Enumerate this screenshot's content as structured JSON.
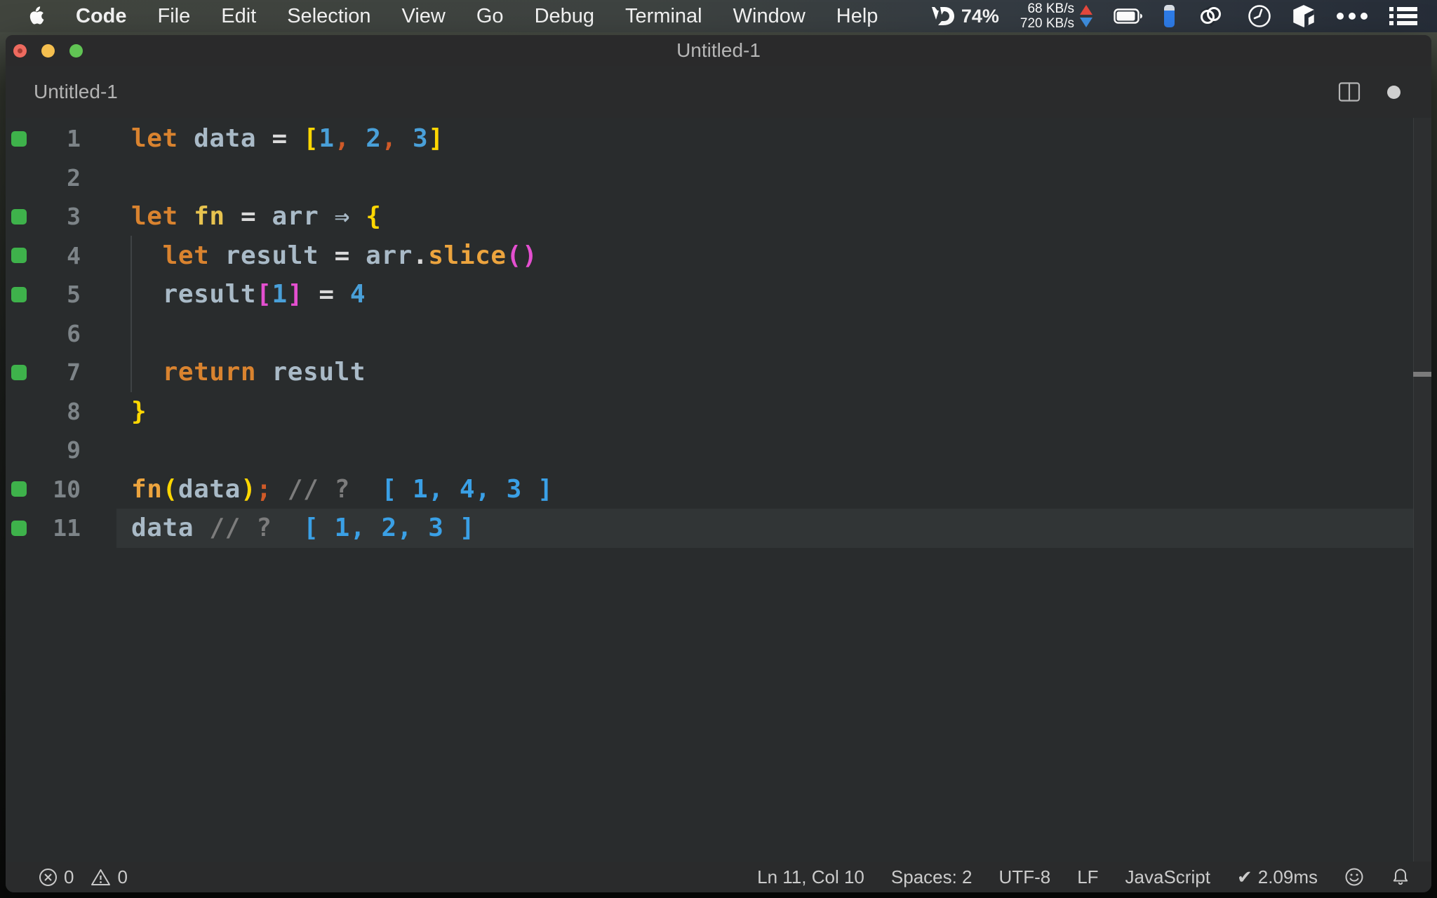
{
  "palette": {
    "kw": "#d9832f",
    "id": "#a9bac7",
    "op": "#d9d9d9",
    "num": "#49a0d9",
    "by": "#ffd702",
    "bm": "#e44fd0",
    "pr": "#cf5a28",
    "fy": "#e7c34f",
    "fa": "#eca43e",
    "cm": "#7c7c7c",
    "ann": "#3aa0e6",
    "ar": "#a9bac7",
    "gutter_green": "#3eb24b",
    "line_num": "#7d8488",
    "editor_bg": "#292c2d",
    "current_line": "#313536",
    "net_up_arrow": "#e5483d",
    "net_down_arrow": "#3f8fe0",
    "traffic_red": "#ee6a5f",
    "traffic_yellow": "#f5bf4f",
    "traffic_green": "#61c454"
  },
  "menubar": {
    "apple_icon": "apple-logo",
    "items": [
      {
        "label": "Code",
        "bold": true
      },
      {
        "label": "File"
      },
      {
        "label": "Edit"
      },
      {
        "label": "Selection"
      },
      {
        "label": "View"
      },
      {
        "label": "Go"
      },
      {
        "label": "Debug"
      },
      {
        "label": "Terminal"
      },
      {
        "label": "Window"
      },
      {
        "label": "Help"
      }
    ],
    "status": {
      "vivid_percent": "74%",
      "net_up": "68 KB/s",
      "net_down": "720 KB/s",
      "icons": [
        "vivid-logo",
        "network-speed",
        "battery",
        "device-battery-pill",
        "rings-app",
        "clock-app",
        "cube-app",
        "more-dots",
        "list-menu"
      ]
    }
  },
  "window": {
    "title": "Untitled-1",
    "tab_label": "Untitled-1"
  },
  "editor": {
    "language_mode": "JavaScript",
    "current_line": 11,
    "lines": [
      {
        "num": "1",
        "marker": true,
        "tokens": [
          {
            "t": "let",
            "c": "kw"
          },
          {
            "t": " "
          },
          {
            "t": "data",
            "c": "id"
          },
          {
            "t": " "
          },
          {
            "t": "=",
            "c": "op"
          },
          {
            "t": " "
          },
          {
            "t": "[",
            "c": "by"
          },
          {
            "t": "1",
            "c": "num"
          },
          {
            "t": ",",
            "c": "pr"
          },
          {
            "t": " "
          },
          {
            "t": "2",
            "c": "num"
          },
          {
            "t": ",",
            "c": "pr"
          },
          {
            "t": " "
          },
          {
            "t": "3",
            "c": "num"
          },
          {
            "t": "]",
            "c": "by"
          }
        ]
      },
      {
        "num": "2",
        "marker": false,
        "tokens": []
      },
      {
        "num": "3",
        "marker": true,
        "tokens": [
          {
            "t": "let",
            "c": "kw"
          },
          {
            "t": " "
          },
          {
            "t": "fn",
            "c": "fy"
          },
          {
            "t": " "
          },
          {
            "t": "=",
            "c": "op"
          },
          {
            "t": " "
          },
          {
            "t": "arr",
            "c": "id"
          },
          {
            "t": " "
          },
          {
            "t": "⇒",
            "c": "ar"
          },
          {
            "t": " "
          },
          {
            "t": "{",
            "c": "by"
          }
        ]
      },
      {
        "num": "4",
        "marker": true,
        "tokens": [
          {
            "t": "  "
          },
          {
            "t": "let",
            "c": "kw"
          },
          {
            "t": " "
          },
          {
            "t": "result",
            "c": "id"
          },
          {
            "t": " "
          },
          {
            "t": "=",
            "c": "op"
          },
          {
            "t": " "
          },
          {
            "t": "arr",
            "c": "id"
          },
          {
            "t": ".",
            "c": "op"
          },
          {
            "t": "slice",
            "c": "fa"
          },
          {
            "t": "(",
            "c": "bm"
          },
          {
            "t": ")",
            "c": "bm"
          }
        ]
      },
      {
        "num": "5",
        "marker": true,
        "tokens": [
          {
            "t": "  "
          },
          {
            "t": "result",
            "c": "id"
          },
          {
            "t": "[",
            "c": "bm"
          },
          {
            "t": "1",
            "c": "num"
          },
          {
            "t": "]",
            "c": "bm"
          },
          {
            "t": " "
          },
          {
            "t": "=",
            "c": "op"
          },
          {
            "t": " "
          },
          {
            "t": "4",
            "c": "num"
          }
        ]
      },
      {
        "num": "6",
        "marker": false,
        "tokens": []
      },
      {
        "num": "7",
        "marker": true,
        "tokens": [
          {
            "t": "  "
          },
          {
            "t": "return",
            "c": "kw"
          },
          {
            "t": " "
          },
          {
            "t": "result",
            "c": "id"
          }
        ]
      },
      {
        "num": "8",
        "marker": false,
        "tokens": [
          {
            "t": "}",
            "c": "by"
          }
        ]
      },
      {
        "num": "9",
        "marker": false,
        "tokens": []
      },
      {
        "num": "10",
        "marker": true,
        "tokens": [
          {
            "t": "fn",
            "c": "fa"
          },
          {
            "t": "(",
            "c": "by"
          },
          {
            "t": "data",
            "c": "id"
          },
          {
            "t": ")",
            "c": "by"
          },
          {
            "t": ";",
            "c": "pr"
          },
          {
            "t": " "
          },
          {
            "t": "//",
            "c": "cm"
          },
          {
            "t": " "
          },
          {
            "t": "?",
            "c": "cm"
          },
          {
            "t": "  "
          },
          {
            "t": "[ 1, 4, 3 ]",
            "c": "ann"
          }
        ]
      },
      {
        "num": "11",
        "marker": true,
        "tokens": [
          {
            "t": "data",
            "c": "id"
          },
          {
            "t": " "
          },
          {
            "t": "//",
            "c": "cm"
          },
          {
            "t": " "
          },
          {
            "t": "?",
            "c": "cm"
          },
          {
            "t": "  "
          },
          {
            "t": "[ 1, 2, 3 ]",
            "c": "ann"
          }
        ]
      }
    ]
  },
  "statusbar": {
    "errors": "0",
    "warnings": "0",
    "cursor": "Ln 11, Col 10",
    "indentation": "Spaces: 2",
    "encoding": "UTF-8",
    "eol": "LF",
    "language": "JavaScript",
    "perf_check": "✔",
    "perf": "2.09ms"
  }
}
